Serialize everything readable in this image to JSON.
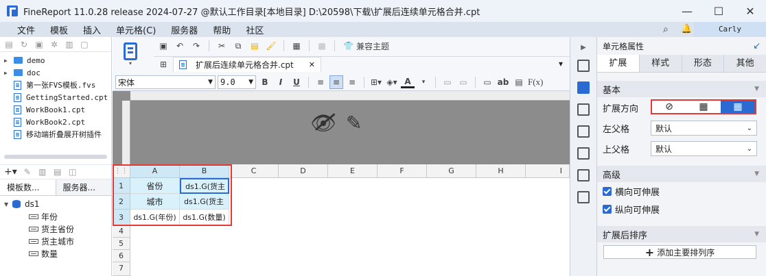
{
  "window": {
    "title": "FineReport 11.0.28 release 2024-07-27 @默认工作目录[本地目录]   D:\\20598\\下载\\扩展后连续单元格合并.cpt",
    "minimize": "—",
    "maximize": "☐",
    "close": "✕"
  },
  "menu": {
    "items": [
      "文件",
      "模板",
      "插入",
      "单元格(C)",
      "服务器",
      "帮助",
      "社区"
    ],
    "user": "Carly"
  },
  "file_tree": {
    "items": [
      {
        "name": "demo",
        "type": "folder"
      },
      {
        "name": "doc",
        "type": "folder"
      },
      {
        "name": "第一张FVS模板.fvs",
        "type": "file"
      },
      {
        "name": "GettingStarted.cpt",
        "type": "file"
      },
      {
        "name": "WorkBook1.cpt",
        "type": "file"
      },
      {
        "name": "WorkBook2.cpt",
        "type": "file"
      },
      {
        "name": "移动端折叠展开树插件",
        "type": "file"
      }
    ]
  },
  "data_panel": {
    "tabs": [
      "模板数...",
      "服务器..."
    ],
    "dataset": "ds1",
    "fields": [
      "年份",
      "货主省份",
      "货主城市",
      "数量"
    ]
  },
  "toolbar": {
    "theme_button": "兼容主题",
    "font_name": "宋体",
    "font_size": "9.0",
    "bold": "B",
    "italic": "I",
    "underline": "U",
    "ab_label": "ab",
    "fx_label": "F(x)"
  },
  "doc_tab": {
    "name": "扩展后连续单元格合并.cpt"
  },
  "grid": {
    "columns": [
      "A",
      "B",
      "C",
      "D",
      "E",
      "F",
      "G",
      "H",
      "I"
    ],
    "rows": [
      "1",
      "2",
      "3",
      "4",
      "5",
      "6",
      "7"
    ],
    "cells": {
      "A1": "省份",
      "B1": "ds1.G(货主",
      "A2": "城市",
      "B2": "ds1.G(货主",
      "A3": "ds1.G(年份)",
      "B3": "ds1.G(数量)"
    }
  },
  "right_panel": {
    "title": "单元格属性",
    "tabs": [
      "扩展",
      "样式",
      "形态",
      "其他"
    ],
    "basic_section": "基本",
    "expand_direction_label": "扩展方向",
    "left_parent_label": "左父格",
    "left_parent_value": "默认",
    "upper_parent_label": "上父格",
    "upper_parent_value": "默认",
    "advanced_section": "高级",
    "horizontal_stretch": "横向可伸展",
    "vertical_stretch": "纵向可伸展",
    "sort_section": "扩展后排序",
    "add_sort_button": "添加主要排列序"
  },
  "colors": {
    "accent": "#2a6ad3",
    "highlight_red": "#e53935",
    "cell_blue": "#d8f1fb"
  }
}
